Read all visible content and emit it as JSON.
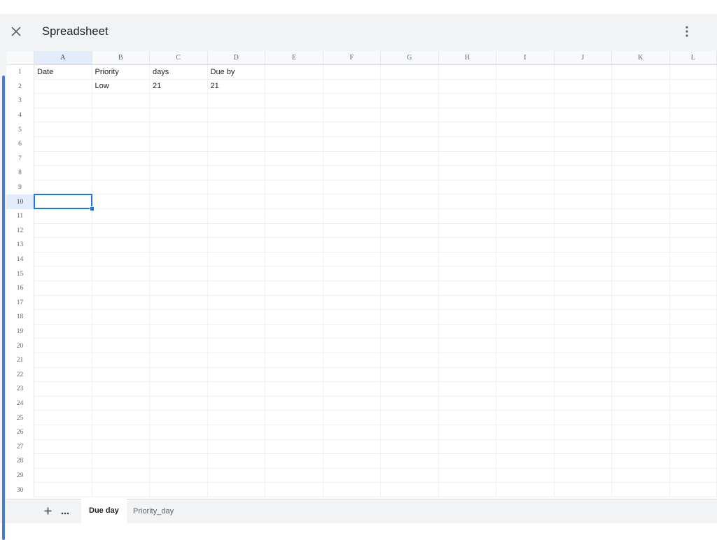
{
  "window": {
    "title": "Spreadsheet"
  },
  "icons": {
    "close": "close-icon",
    "menu": "more-vert-icon",
    "add": "plus-icon",
    "more": "more-horiz-icon"
  },
  "colors": {
    "accent": "#1a73e8",
    "header_selected": "#e3ecfb",
    "left_accent": "#4a7bd0"
  },
  "columns": [
    "A",
    "B",
    "C",
    "D",
    "E",
    "F",
    "G",
    "H",
    "I",
    "J",
    "K",
    "L"
  ],
  "rows": [
    "1",
    "2",
    "3",
    "4",
    "5",
    "6",
    "7",
    "8",
    "9",
    "10",
    "11",
    "12",
    "13",
    "14",
    "15",
    "16",
    "17",
    "18",
    "19",
    "20",
    "21",
    "22",
    "23",
    "24",
    "25",
    "26",
    "27",
    "28",
    "29",
    "30"
  ],
  "cells": [
    [
      "Date",
      "Priority",
      "days",
      "Due by"
    ],
    [
      "",
      "Low",
      "21",
      "21"
    ]
  ],
  "selection": {
    "column": "A",
    "row": "10"
  },
  "tabs": [
    {
      "label": "Due day",
      "active": true
    },
    {
      "label": "Priority_day",
      "active": false
    }
  ]
}
